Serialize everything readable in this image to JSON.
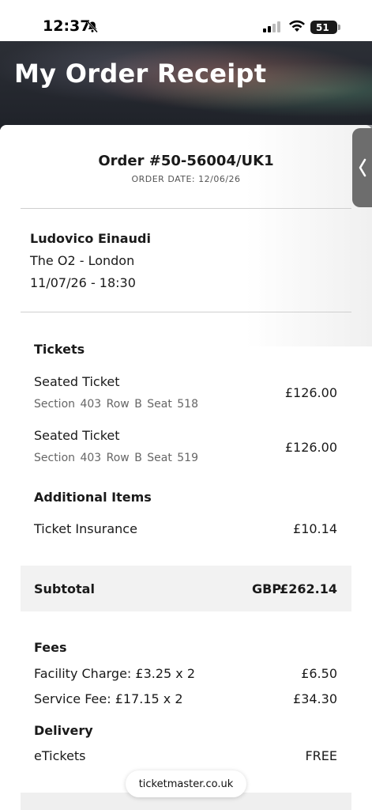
{
  "status_bar": {
    "time": "12:37",
    "battery": "51",
    "icons": [
      "bell-slash-icon",
      "signal-icon",
      "wifi-icon",
      "battery-icon"
    ]
  },
  "header": {
    "title": "My Order Receipt"
  },
  "order": {
    "number": "Order #50-56004/UK1",
    "date": "ORDER DATE: 12/06/26"
  },
  "event": {
    "name": "Ludovico Einaudi",
    "venue": "The O2 - London",
    "datetime": "11/07/26 - 18:30"
  },
  "tickets": {
    "heading": "Tickets",
    "items": [
      {
        "label": "Seated Ticket",
        "detail": "Section 403  Row B  Seat 518",
        "price": "£126.00"
      },
      {
        "label": "Seated Ticket",
        "detail": "Section 403  Row B  Seat 519",
        "price": "£126.00"
      }
    ]
  },
  "additional": {
    "heading": "Additional Items",
    "items": [
      {
        "label": "Ticket Insurance",
        "price": "£10.14"
      }
    ]
  },
  "subtotal": {
    "label": "Subtotal",
    "currency": "GBP",
    "amount": "£262.14"
  },
  "fees": {
    "heading": "Fees",
    "items": [
      {
        "label": "Facility Charge: £3.25 x 2",
        "price": "£6.50"
      },
      {
        "label": "Service Fee: £17.15 x 2",
        "price": "£34.30"
      }
    ]
  },
  "delivery": {
    "heading": "Delivery",
    "items": [
      {
        "label": "eTickets",
        "price": "FREE"
      }
    ]
  },
  "browser": {
    "url": "ticketmaster.co.uk"
  },
  "colors": {
    "hero_bg": "#23262d",
    "side_tab": "#6d6d6d",
    "subtotal_bg": "#f2f2f2"
  }
}
